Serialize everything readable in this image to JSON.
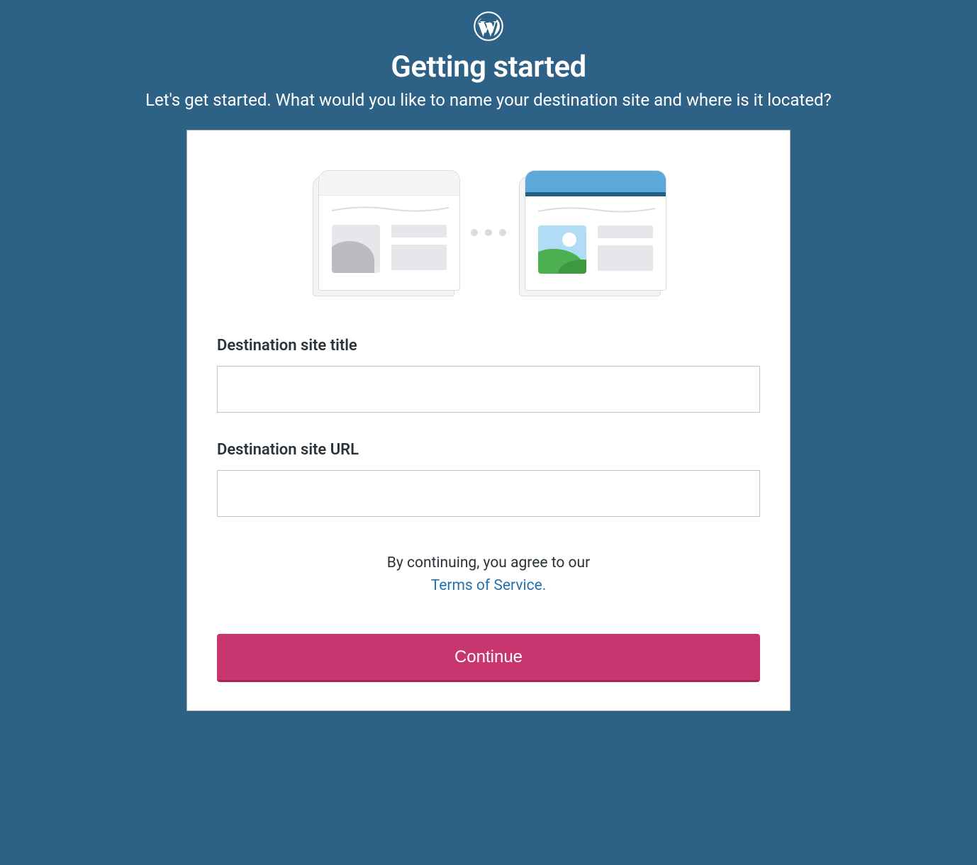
{
  "header": {
    "title": "Getting started",
    "subtitle": "Let's get started. What would you like to name your destination site and where is it located?"
  },
  "form": {
    "site_title": {
      "label": "Destination site title",
      "value": ""
    },
    "site_url": {
      "label": "Destination site URL",
      "value": ""
    }
  },
  "tos": {
    "prefix": "By continuing, you agree to our ",
    "link_text": "Terms of Service."
  },
  "buttons": {
    "continue": "Continue"
  },
  "icons": {
    "logo": "wordpress-logo"
  },
  "colors": {
    "background": "#2d6286",
    "primary_button": "#c9356e",
    "link": "#2271b1"
  }
}
